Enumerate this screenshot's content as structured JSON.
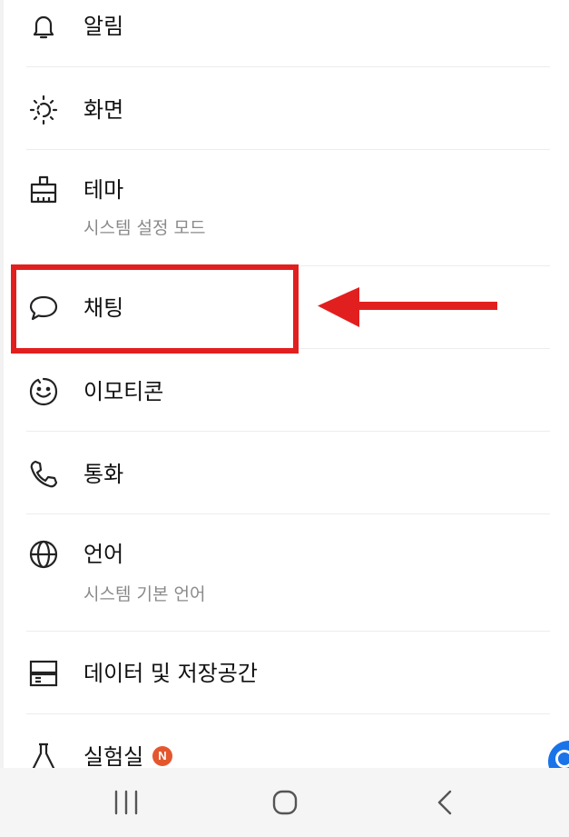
{
  "settings": {
    "items": [
      {
        "key": "notifications",
        "label": "알림",
        "icon": "bell-icon"
      },
      {
        "key": "display",
        "label": "화면",
        "icon": "brightness-icon"
      },
      {
        "key": "theme",
        "label": "테마",
        "sublabel": "시스템 설정 모드",
        "icon": "paint-brush-icon"
      },
      {
        "key": "chat",
        "label": "채팅",
        "icon": "chat-bubble-icon"
      },
      {
        "key": "emoticon",
        "label": "이모티콘",
        "icon": "smiley-icon"
      },
      {
        "key": "call",
        "label": "통화",
        "icon": "phone-icon"
      },
      {
        "key": "language",
        "label": "언어",
        "sublabel": "시스템 기본 언어",
        "icon": "globe-icon"
      },
      {
        "key": "storage",
        "label": "데이터 및 저장공간",
        "icon": "storage-icon"
      },
      {
        "key": "labs",
        "label": "실험실",
        "badge": "N",
        "icon": "flask-icon"
      }
    ]
  },
  "annotation": {
    "highlight_color": "#e21f1f",
    "target": "chat"
  },
  "navbar": {
    "buttons": [
      "recent-apps-icon",
      "home-icon",
      "back-icon"
    ]
  },
  "colors": {
    "badge": "#e4572e",
    "fab": "#1a73e8"
  }
}
